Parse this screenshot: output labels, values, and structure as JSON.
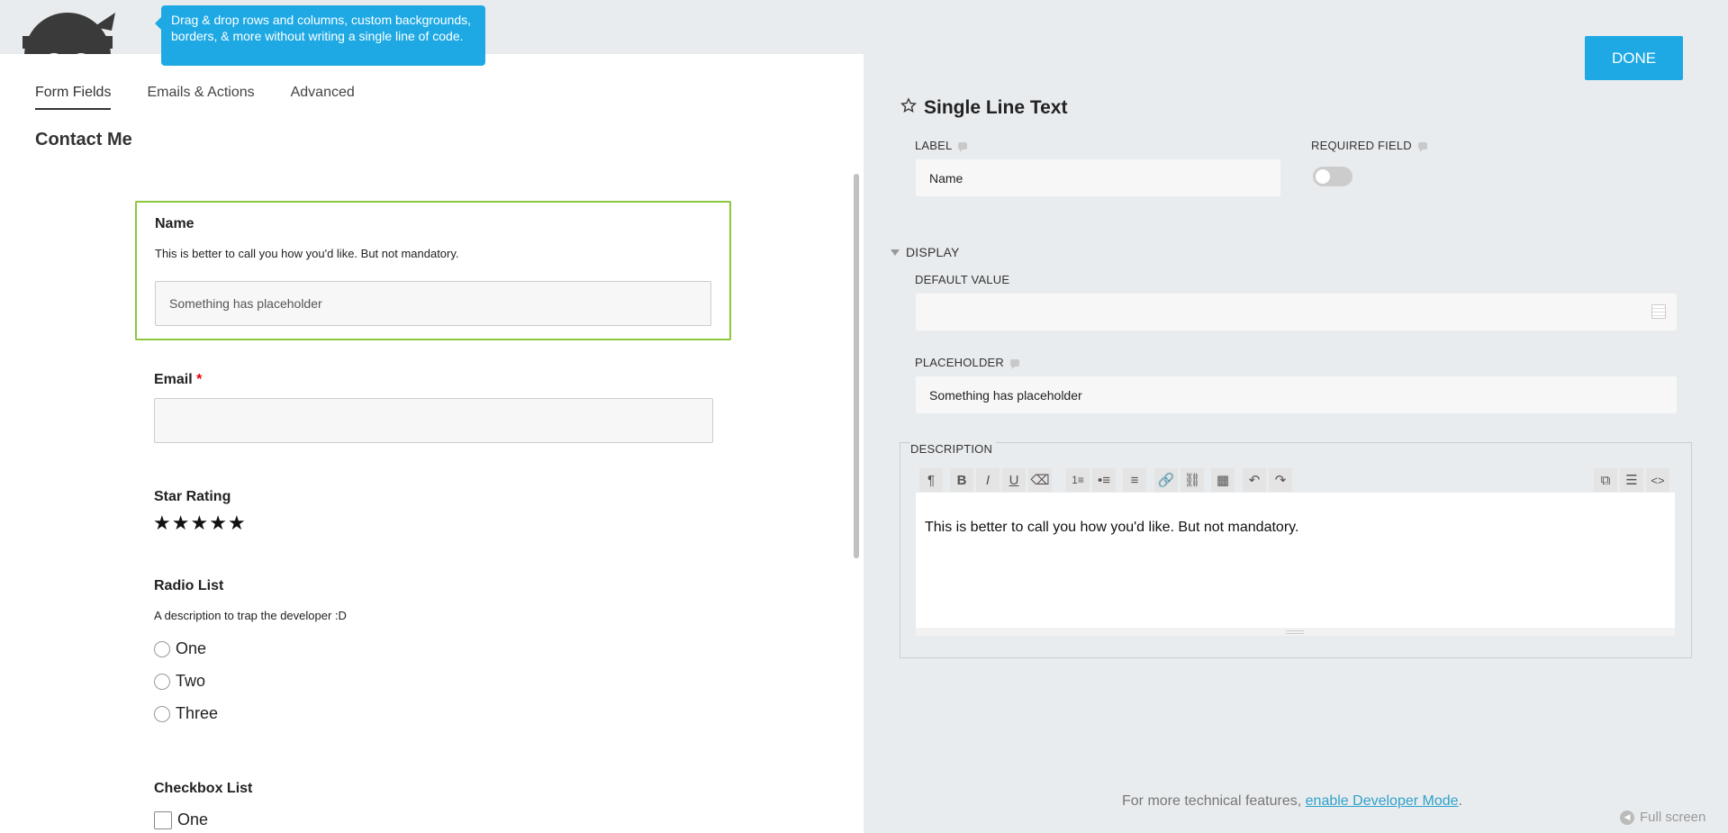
{
  "tooltip": {
    "text": "Drag & drop rows and columns, custom backgrounds, borders, & more without writing a single line of code."
  },
  "tabs": [
    {
      "label": "Form Fields"
    },
    {
      "label": "Emails & Actions"
    },
    {
      "label": "Advanced"
    }
  ],
  "form": {
    "title": "Contact Me",
    "name_field": {
      "label": "Name",
      "description": "This is better to call you how you'd like. But not mandatory.",
      "placeholder": "Something has placeholder"
    },
    "email_field": {
      "label": "Email",
      "required_mark": "*",
      "value": ""
    },
    "star_field": {
      "label": "Star Rating",
      "stars": [
        "★",
        "★",
        "★",
        "★",
        "★"
      ]
    },
    "radio_field": {
      "label": "Radio List",
      "description": "A description to trap the developer :D",
      "options": [
        "One",
        "Two",
        "Three"
      ]
    },
    "checkbox_field": {
      "label": "Checkbox List",
      "options": [
        "One"
      ]
    }
  },
  "panel": {
    "done_label": "DONE",
    "title": "Single Line Text",
    "label_label": "LABEL",
    "label_value": "Name",
    "required_label": "REQUIRED FIELD",
    "required_on": false,
    "display_label": "DISPLAY",
    "default_value_label": "DEFAULT VALUE",
    "default_value": "",
    "placeholder_label": "PLACEHOLDER",
    "placeholder_value": "Something has placeholder",
    "description_label": "DESCRIPTION",
    "description_value": "This is better to call you how you'd like. But not mandatory.",
    "toolbar_icons": [
      "paragraph-icon",
      "bold-icon",
      "italic-icon",
      "underline-icon",
      "eraser-icon",
      "ordered-list-icon",
      "unordered-list-icon",
      "align-left-icon",
      "link-icon",
      "unlink-icon",
      "table-icon",
      "undo-icon",
      "redo-icon",
      "merge-tags-icon",
      "html-list-icon",
      "code-icon"
    ]
  },
  "footer": {
    "text": "For more technical features,",
    "link": "enable Developer Mode",
    "end": ".",
    "fullscreen": "Full screen"
  },
  "colors": {
    "accent": "#1ea9e4",
    "active_border": "#8dc63f",
    "required": "#e80000"
  }
}
